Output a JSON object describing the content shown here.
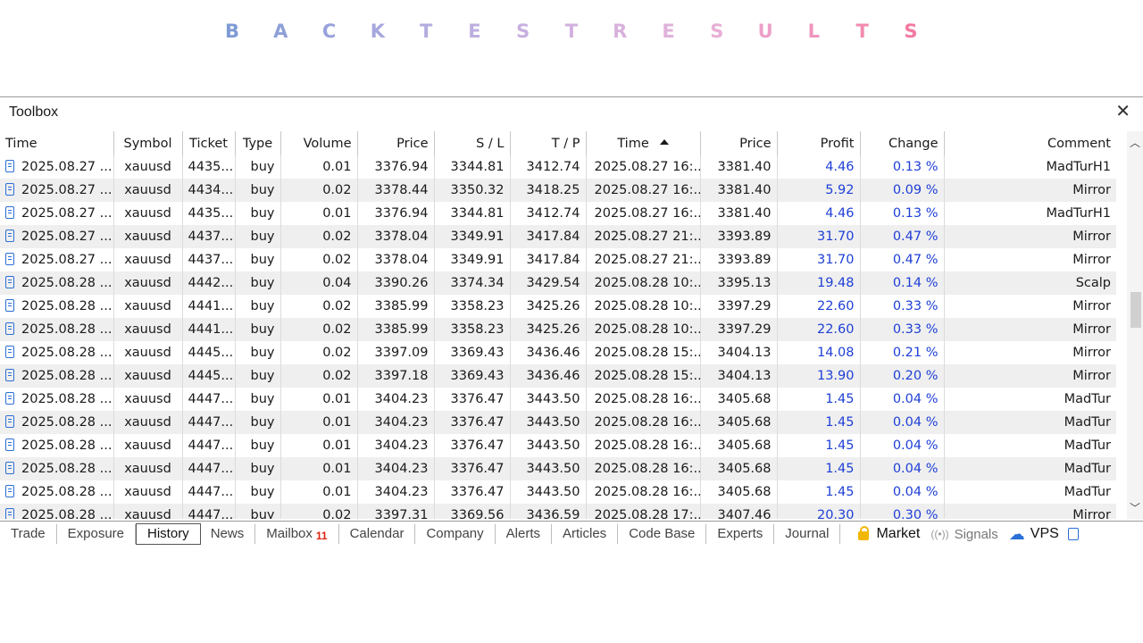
{
  "banner": {
    "letters": [
      "B",
      "A",
      "C",
      "K",
      "T",
      "E",
      "S",
      "T",
      "R",
      "E",
      "S",
      "U",
      "L",
      "T",
      "S"
    ],
    "colors": [
      "#7f9bd6",
      "#8fa0d8",
      "#98a2dc",
      "#a6a7de",
      "#b2acde",
      "#bdaedf",
      "#c7b0e0",
      "#d2b1df",
      "#d9b2dd",
      "#e0b2da",
      "#e7aed5",
      "#ec9fc8",
      "#ef95bd",
      "#f28aaf",
      "#f37aa0"
    ]
  },
  "toolbox": {
    "title": "Toolbox",
    "columns": [
      "Time",
      "Symbol",
      "Ticket",
      "Type",
      "Volume",
      "Price",
      "S / L",
      "T / P",
      "Time",
      "Price",
      "Profit",
      "Change",
      "Comment"
    ],
    "rows": [
      [
        "2025.08.27 ...",
        "xauusd",
        "4435...",
        "buy",
        "0.01",
        "3376.94",
        "3344.81",
        "3412.74",
        "2025.08.27 16:...",
        "3381.40",
        "4.46",
        "0.13 %",
        "MadTurH1"
      ],
      [
        "2025.08.27 ...",
        "xauusd",
        "4434...",
        "buy",
        "0.02",
        "3378.44",
        "3350.32",
        "3418.25",
        "2025.08.27 16:...",
        "3381.40",
        "5.92",
        "0.09 %",
        "Mirror"
      ],
      [
        "2025.08.27 ...",
        "xauusd",
        "4435...",
        "buy",
        "0.01",
        "3376.94",
        "3344.81",
        "3412.74",
        "2025.08.27 16:...",
        "3381.40",
        "4.46",
        "0.13 %",
        "MadTurH1"
      ],
      [
        "2025.08.27 ...",
        "xauusd",
        "4437...",
        "buy",
        "0.02",
        "3378.04",
        "3349.91",
        "3417.84",
        "2025.08.27 21:...",
        "3393.89",
        "31.70",
        "0.47 %",
        "Mirror"
      ],
      [
        "2025.08.27 ...",
        "xauusd",
        "4437...",
        "buy",
        "0.02",
        "3378.04",
        "3349.91",
        "3417.84",
        "2025.08.27 21:...",
        "3393.89",
        "31.70",
        "0.47 %",
        "Mirror"
      ],
      [
        "2025.08.28 ...",
        "xauusd",
        "4442...",
        "buy",
        "0.04",
        "3390.26",
        "3374.34",
        "3429.54",
        "2025.08.28 10:...",
        "3395.13",
        "19.48",
        "0.14 %",
        "Scalp"
      ],
      [
        "2025.08.28 ...",
        "xauusd",
        "4441...",
        "buy",
        "0.02",
        "3385.99",
        "3358.23",
        "3425.26",
        "2025.08.28 10:...",
        "3397.29",
        "22.60",
        "0.33 %",
        "Mirror"
      ],
      [
        "2025.08.28 ...",
        "xauusd",
        "4441...",
        "buy",
        "0.02",
        "3385.99",
        "3358.23",
        "3425.26",
        "2025.08.28 10:...",
        "3397.29",
        "22.60",
        "0.33 %",
        "Mirror"
      ],
      [
        "2025.08.28 ...",
        "xauusd",
        "4445...",
        "buy",
        "0.02",
        "3397.09",
        "3369.43",
        "3436.46",
        "2025.08.28 15:...",
        "3404.13",
        "14.08",
        "0.21 %",
        "Mirror"
      ],
      [
        "2025.08.28 ...",
        "xauusd",
        "4445...",
        "buy",
        "0.02",
        "3397.18",
        "3369.43",
        "3436.46",
        "2025.08.28 15:...",
        "3404.13",
        "13.90",
        "0.20 %",
        "Mirror"
      ],
      [
        "2025.08.28 ...",
        "xauusd",
        "4447...",
        "buy",
        "0.01",
        "3404.23",
        "3376.47",
        "3443.50",
        "2025.08.28 16:...",
        "3405.68",
        "1.45",
        "0.04 %",
        "MadTur"
      ],
      [
        "2025.08.28 ...",
        "xauusd",
        "4447...",
        "buy",
        "0.01",
        "3404.23",
        "3376.47",
        "3443.50",
        "2025.08.28 16:...",
        "3405.68",
        "1.45",
        "0.04 %",
        "MadTur"
      ],
      [
        "2025.08.28 ...",
        "xauusd",
        "4447...",
        "buy",
        "0.01",
        "3404.23",
        "3376.47",
        "3443.50",
        "2025.08.28 16:...",
        "3405.68",
        "1.45",
        "0.04 %",
        "MadTur"
      ],
      [
        "2025.08.28 ...",
        "xauusd",
        "4447...",
        "buy",
        "0.01",
        "3404.23",
        "3376.47",
        "3443.50",
        "2025.08.28 16:...",
        "3405.68",
        "1.45",
        "0.04 %",
        "MadTur"
      ],
      [
        "2025.08.28 ...",
        "xauusd",
        "4447...",
        "buy",
        "0.01",
        "3404.23",
        "3376.47",
        "3443.50",
        "2025.08.28 16:...",
        "3405.68",
        "1.45",
        "0.04 %",
        "MadTur"
      ],
      [
        "2025.08.28 ...",
        "xauusd",
        "4447...",
        "buy",
        "0.02",
        "3397.31",
        "3369.56",
        "3436.59",
        "2025.08.28 17:...",
        "3407.46",
        "20.30",
        "0.30 %",
        "Mirror"
      ]
    ],
    "tabs": [
      {
        "label": "Trade"
      },
      {
        "label": "Exposure"
      },
      {
        "label": "History",
        "active": true
      },
      {
        "label": "News"
      },
      {
        "label": "Mailbox",
        "badge": "11"
      },
      {
        "label": "Calendar"
      },
      {
        "label": "Company"
      },
      {
        "label": "Alerts"
      },
      {
        "label": "Articles"
      },
      {
        "label": "Code Base"
      },
      {
        "label": "Experts"
      },
      {
        "label": "Journal"
      }
    ],
    "right_tabs": {
      "market": "Market",
      "signals": "Signals",
      "vps": "VPS"
    }
  }
}
